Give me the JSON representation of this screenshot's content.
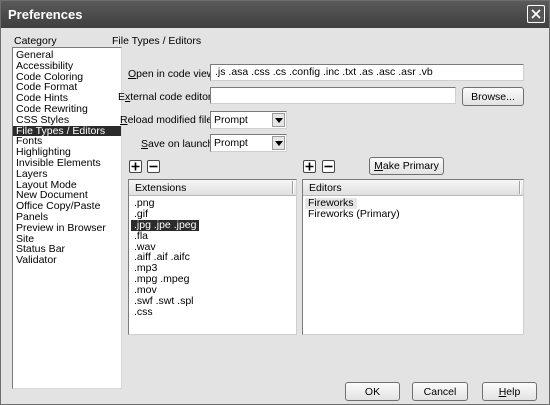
{
  "window": {
    "title": "Preferences",
    "close_icon": "close-icon"
  },
  "category": {
    "label": "Category",
    "items": [
      {
        "label": "General",
        "selected": false
      },
      {
        "label": "Accessibility",
        "selected": false
      },
      {
        "label": "Code Coloring",
        "selected": false
      },
      {
        "label": "Code Format",
        "selected": false
      },
      {
        "label": "Code Hints",
        "selected": false
      },
      {
        "label": "Code Rewriting",
        "selected": false
      },
      {
        "label": "CSS Styles",
        "selected": false
      },
      {
        "label": "File Types / Editors",
        "selected": true
      },
      {
        "label": "Fonts",
        "selected": false
      },
      {
        "label": "Highlighting",
        "selected": false
      },
      {
        "label": "Invisible Elements",
        "selected": false
      },
      {
        "label": "Layers",
        "selected": false
      },
      {
        "label": "Layout Mode",
        "selected": false
      },
      {
        "label": "New Document",
        "selected": false
      },
      {
        "label": "Office Copy/Paste",
        "selected": false
      },
      {
        "label": "Panels",
        "selected": false
      },
      {
        "label": "Preview in Browser",
        "selected": false
      },
      {
        "label": "Site",
        "selected": false
      },
      {
        "label": "Status Bar",
        "selected": false
      },
      {
        "label": "Validator",
        "selected": false
      }
    ]
  },
  "section": {
    "title": "File Types / Editors"
  },
  "form": {
    "open_in_code_view_label": "Open in code view:",
    "open_in_code_view_value": ".js .asa .css .cs .config .inc .txt .as .asc .asr .vb",
    "external_editor_label": "External code editor:",
    "external_editor_value": "",
    "browse_label": "Browse...",
    "reload_label": "Reload modified files:",
    "reload_value": "Prompt",
    "save_label": "Save on launch:",
    "save_value": "Prompt"
  },
  "extensions": {
    "header": "Extensions",
    "add_icon": "plus-icon",
    "remove_icon": "minus-icon",
    "items": [
      {
        "label": ".png",
        "selected": false
      },
      {
        "label": ".gif",
        "selected": false
      },
      {
        "label": ".jpg .jpe .jpeg",
        "selected": true
      },
      {
        "label": ".fla",
        "selected": false
      },
      {
        "label": ".wav",
        "selected": false
      },
      {
        "label": ".aiff .aif .aifc",
        "selected": false
      },
      {
        "label": ".mp3",
        "selected": false
      },
      {
        "label": ".mpg .mpeg",
        "selected": false
      },
      {
        "label": ".mov",
        "selected": false
      },
      {
        "label": ".swf .swt .spl",
        "selected": false
      },
      {
        "label": ".css",
        "selected": false
      }
    ]
  },
  "editors": {
    "header": "Editors",
    "make_primary_label": "Make Primary",
    "items": [
      {
        "label": "Fireworks",
        "highlight": true
      },
      {
        "label": "Fireworks (Primary)",
        "highlight": false
      }
    ]
  },
  "buttons": {
    "ok": "OK",
    "cancel": "Cancel",
    "help": "Help"
  }
}
